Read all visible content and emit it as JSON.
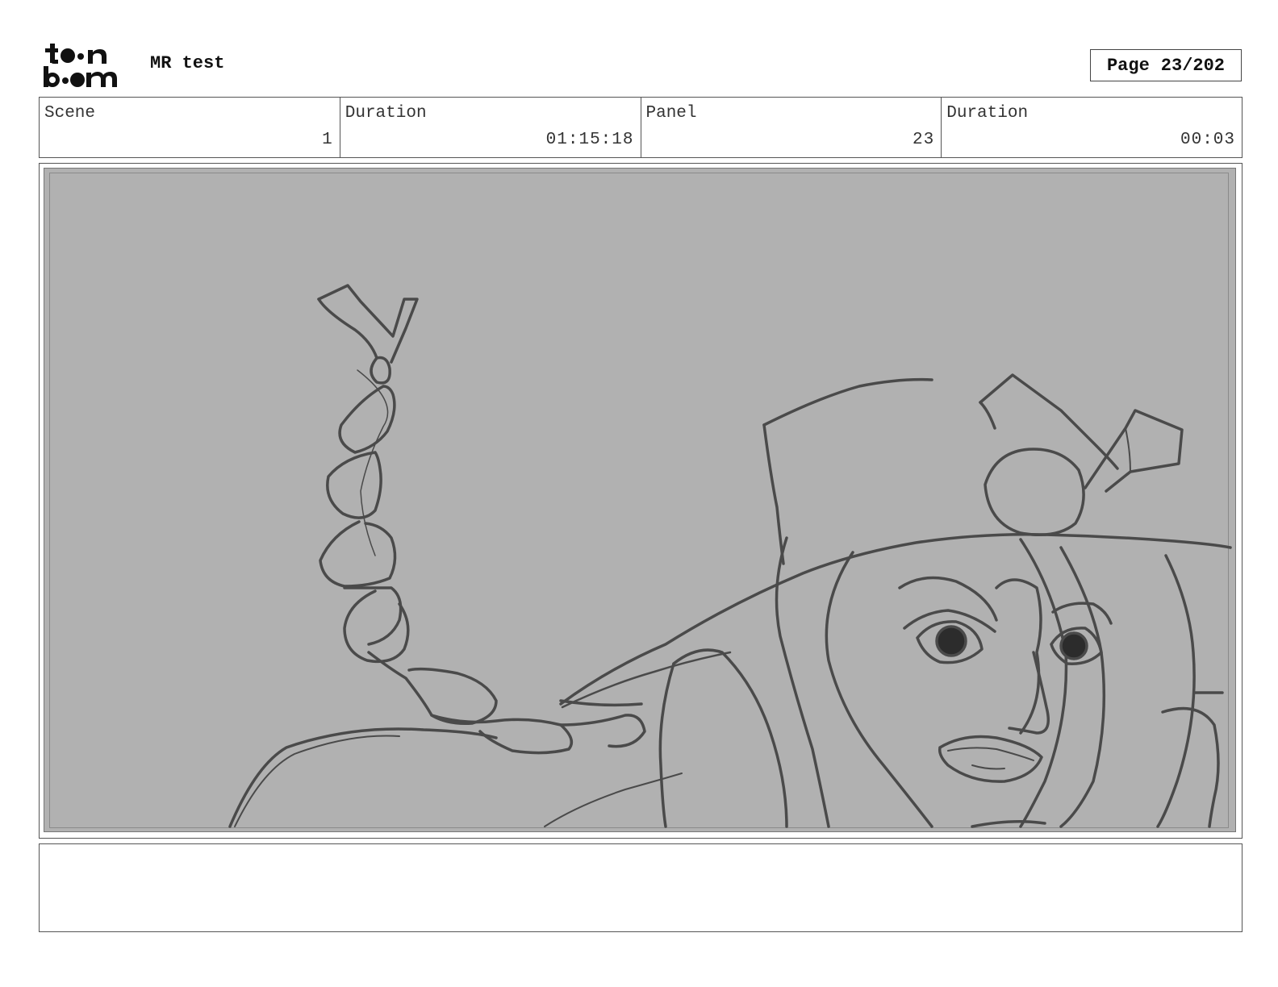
{
  "header": {
    "logo": {
      "text_line1": "toon",
      "text_line2": "boom"
    },
    "project_title": "MR test",
    "page_label": "Page",
    "page_value": "23/202"
  },
  "info": {
    "scene_label": "Scene",
    "scene_value": "1",
    "scene_duration_label": "Duration",
    "scene_duration_value": "01:15:18",
    "panel_label": "Panel",
    "panel_value": "23",
    "panel_duration_label": "Duration",
    "panel_duration_value": "00:03"
  },
  "panel": {
    "background_color": "#b1b1b1",
    "sketch_color": "#4a4a4a"
  },
  "notes": {
    "text": ""
  }
}
